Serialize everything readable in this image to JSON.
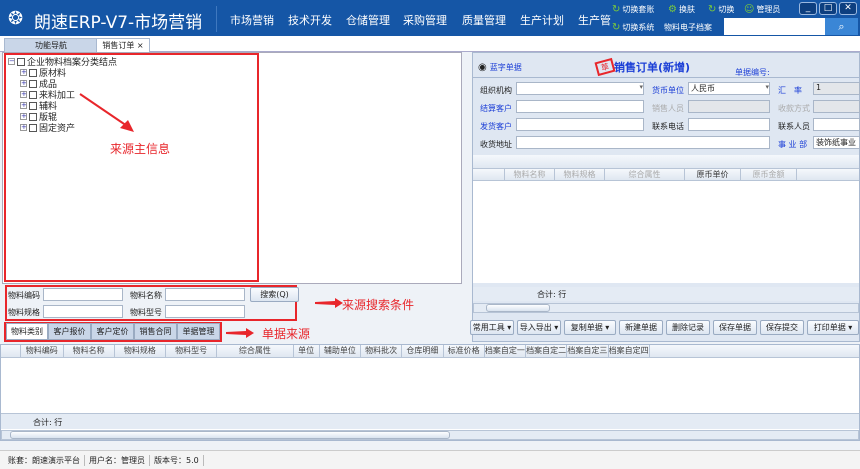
{
  "app": {
    "title": "朗速ERP-V7-市场营销",
    "logo_icon": "logo-swirl-icon"
  },
  "nav": [
    "市场营销",
    "技术开发",
    "仓储管理",
    "采购管理",
    "质量管理",
    "生产计划",
    "生产管"
  ],
  "tools": {
    "switch_account": "切换套账",
    "skin": "换肤",
    "switch": "切换",
    "user": "管理员",
    "switch_system": "切换系统",
    "material_archive": "物料电子档案",
    "search_value": ""
  },
  "tabs": [
    {
      "label": "功能导航"
    },
    {
      "label": "销售订单",
      "close": "×"
    }
  ],
  "tree": {
    "root": "企业物料档案分类结点",
    "children": [
      "原材料",
      "成品",
      "来料加工",
      "辅料",
      "版辊",
      "固定资产"
    ]
  },
  "annotations": {
    "source_main": "来源主信息",
    "search_cond": "来源搜索条件",
    "doc_source": "单据来源"
  },
  "search": {
    "code_label": "物料编码",
    "name_label": "物料名称",
    "spec_label": "物料规格",
    "model_label": "物料型号",
    "button": "搜索(Q)"
  },
  "source_tabs": [
    "物料类别",
    "客户报价",
    "客户定价",
    "销售合同",
    "单据管理"
  ],
  "order": {
    "radio_label": "蓝字单据",
    "stamp": "草",
    "title": "销售订单(新增)",
    "doc_no_label": "单据编号:",
    "fields": {
      "org": "组织机构",
      "currency": "货币单位",
      "currency_value": "人民币",
      "rate": "汇　率",
      "rate_value": "1",
      "settle": "结算客户",
      "sales": "销售人员",
      "pay": "收款方式",
      "ship": "发货客户",
      "phone": "联系电话",
      "contact": "联系人员",
      "addr": "收货地址",
      "dept": "事 业 部",
      "dept_value": "装饰纸事业"
    },
    "columns": [
      "物料名称",
      "物料规格",
      "综合属性",
      "原币单价",
      "原币金额"
    ],
    "total": "合计: 行",
    "buttons": [
      "常用工具 ▾",
      "导入导出 ▾",
      "复制单据 ▾",
      "新建单据",
      "删除记录",
      "保存单据",
      "保存提交",
      "打印单据 ▾"
    ]
  },
  "bottom": {
    "columns": [
      "物料编码",
      "物料名称",
      "物料规格",
      "物料型号",
      "综合属性",
      "单位",
      "辅助单位",
      "物料批次",
      "仓库明细",
      "标准价格",
      "档案自定一",
      "档案自定二",
      "档案自定三",
      "档案自定四"
    ],
    "total": "合计: 行"
  },
  "status": [
    "账套：朗速演示平台",
    "用户名：管理员",
    "版本号：5.0"
  ],
  "colors": {
    "header": "#1556a6",
    "annotation": "#e8262b",
    "label_blue": "#1b3ed6"
  }
}
